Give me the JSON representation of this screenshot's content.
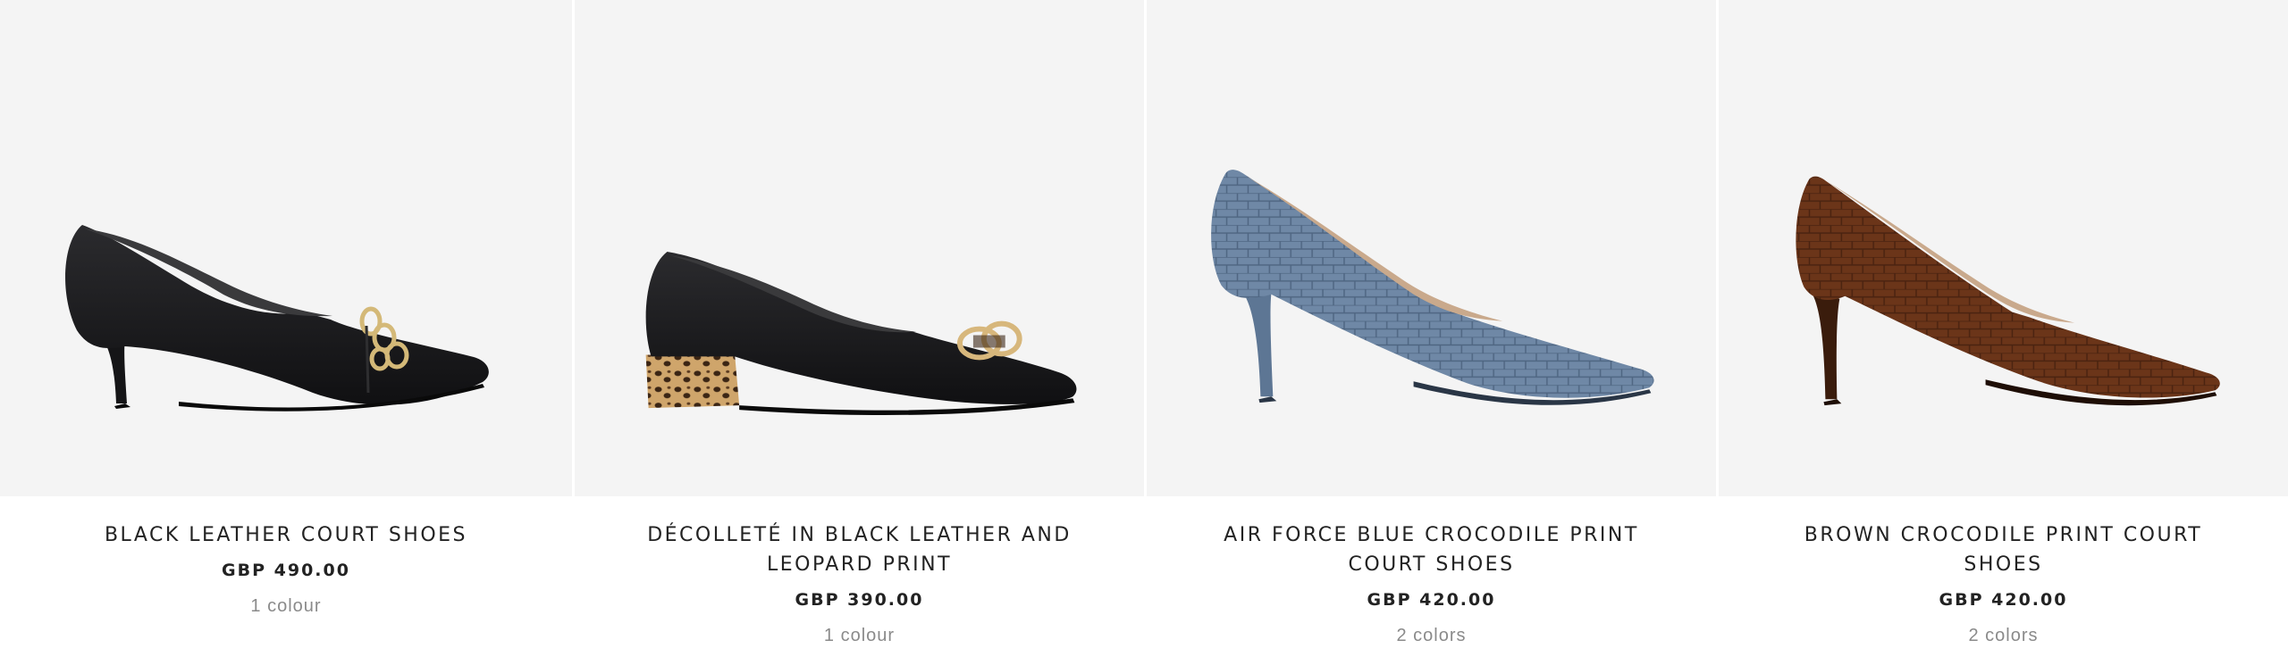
{
  "products": [
    {
      "title": "BLACK LEATHER COURT SHOES",
      "price": "GBP 490.00",
      "colours": "1 colour",
      "shoe": {
        "upper": "#1c1c1e",
        "upper_shade": "#0e0e10",
        "heel": "#1c1c1e",
        "lining": "#2a2a2a",
        "accessory": "chain",
        "icon": "black-leather-court-shoe-icon"
      }
    },
    {
      "title": "DÉCOLLETÉ IN BLACK LEATHER AND LEOPARD PRINT",
      "price": "GBP 390.00",
      "colours": "1 colour",
      "shoe": {
        "upper": "#1c1c1e",
        "upper_shade": "#0e0e10",
        "heel": "#c79a5e",
        "lining": "#2a2a2a",
        "accessory": "buckle",
        "icon": "black-leopard-flat-shoe-icon"
      }
    },
    {
      "title": "AIR FORCE BLUE CROCODILE PRINT COURT SHOES",
      "price": "GBP 420.00",
      "colours": "2 colors",
      "shoe": {
        "upper": "#6f88a6",
        "upper_shade": "#56708e",
        "heel": "#6f88a6",
        "lining": "#c9a98c",
        "accessory": "none",
        "icon": "blue-croc-pump-icon"
      }
    },
    {
      "title": "BROWN CROCODILE PRINT COURT SHOES",
      "price": "GBP 420.00",
      "colours": "2 colors",
      "shoe": {
        "upper": "#6b3519",
        "upper_shade": "#4a2310",
        "heel": "#4a2310",
        "lining": "#c9a98c",
        "accessory": "none",
        "icon": "brown-croc-pump-icon"
      }
    }
  ]
}
